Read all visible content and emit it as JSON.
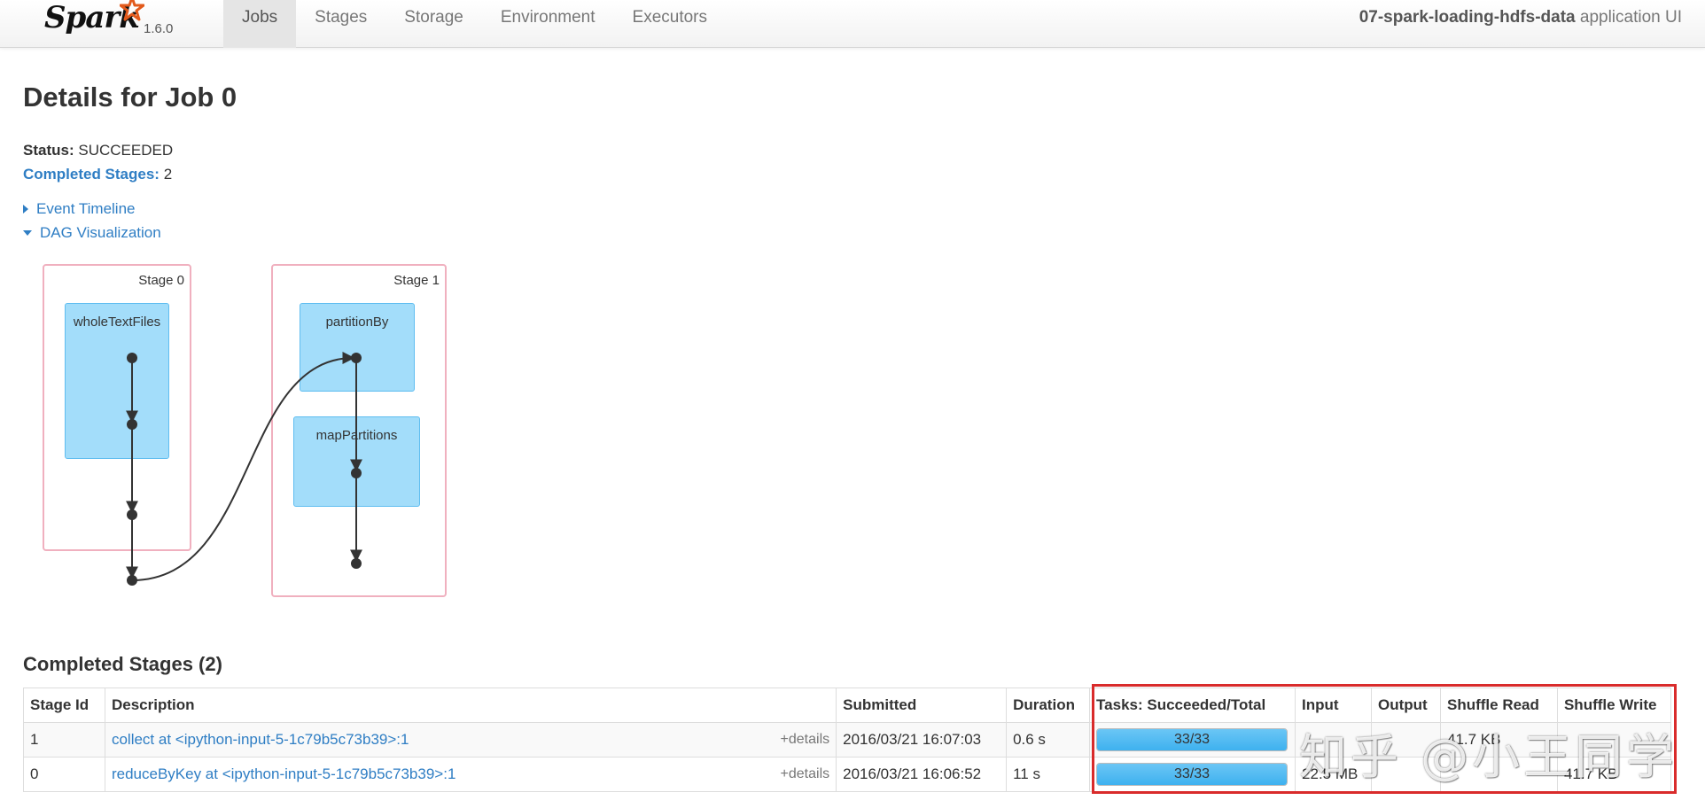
{
  "navbar": {
    "brand": "Spark",
    "version": "1.6.0",
    "tabs": [
      {
        "label": "Jobs",
        "active": true
      },
      {
        "label": "Stages",
        "active": false
      },
      {
        "label": "Storage",
        "active": false
      },
      {
        "label": "Environment",
        "active": false
      },
      {
        "label": "Executors",
        "active": false
      }
    ],
    "app_name": "07-spark-loading-hdfs-data",
    "app_suffix": " application UI"
  },
  "page": {
    "title": "Details for Job 0",
    "status_label": "Status:",
    "status_value": "SUCCEEDED",
    "completed_label": "Completed Stages:",
    "completed_value": "2",
    "event_timeline": "Event Timeline",
    "dag_visualization": "DAG Visualization"
  },
  "dag": {
    "stages": [
      {
        "label": "Stage 0",
        "operations": [
          "wholeTextFiles"
        ]
      },
      {
        "label": "Stage 1",
        "operations": [
          "partitionBy",
          "mapPartitions"
        ]
      }
    ]
  },
  "completed_stages": {
    "title": "Completed Stages (2)",
    "columns": [
      "Stage Id",
      "Description",
      "Submitted",
      "Duration",
      "Tasks: Succeeded/Total",
      "Input",
      "Output",
      "Shuffle Read",
      "Shuffle Write"
    ],
    "details_label": "+details",
    "rows": [
      {
        "stage_id": "1",
        "description": "collect at <ipython-input-5-1c79b5c73b39>:1",
        "submitted": "2016/03/21 16:07:03",
        "duration": "0.6 s",
        "tasks": "33/33",
        "tasks_fraction": 1.0,
        "input": "",
        "output": "",
        "shuffle_read": "41.7 KB",
        "shuffle_write": ""
      },
      {
        "stage_id": "0",
        "description": "reduceByKey at <ipython-input-5-1c79b5c73b39>:1",
        "submitted": "2016/03/21 16:06:52",
        "duration": "11 s",
        "tasks": "33/33",
        "tasks_fraction": 1.0,
        "input": "22.5 MB",
        "output": "",
        "shuffle_read": "",
        "shuffle_write": "41.7 KB"
      }
    ]
  },
  "watermark": "知乎 @小王同学",
  "colors": {
    "link": "#2f7ec4",
    "rdd_fill": "#a3ddfa",
    "stage_border": "#f0b0bf",
    "highlight": "#d92b2b",
    "progress": "#3eb1ef"
  }
}
